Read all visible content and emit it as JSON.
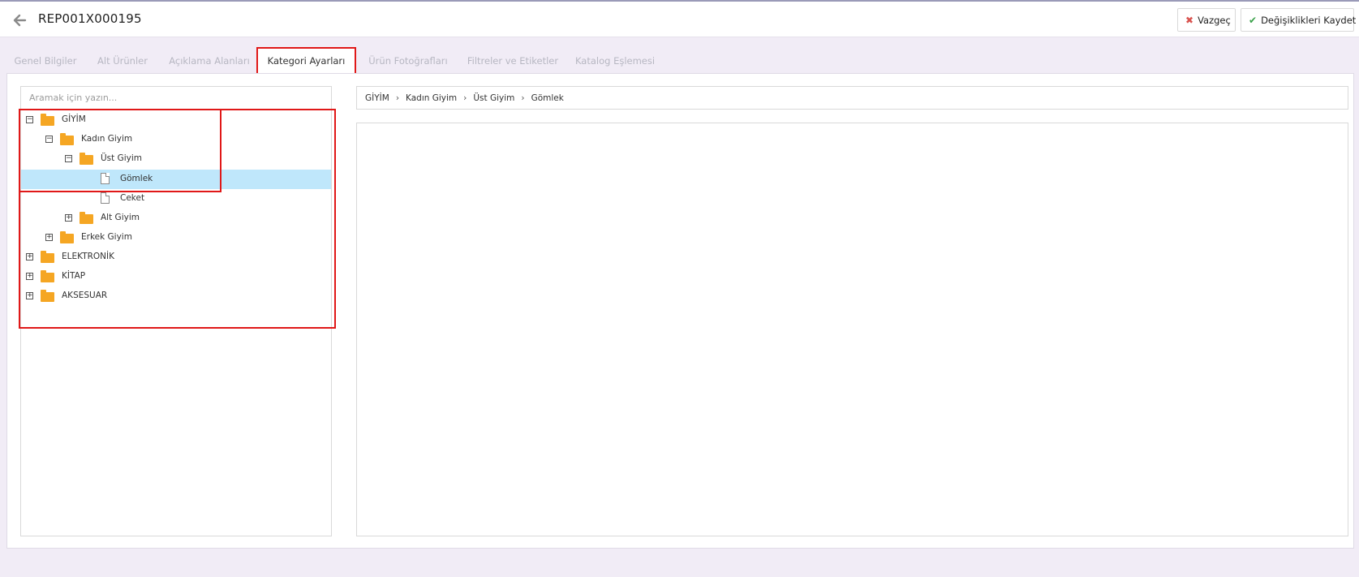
{
  "header": {
    "title": "REP001X000195",
    "cancel_label": "Vazgeç",
    "save_label": "Değişiklikleri Kaydet"
  },
  "tabs": [
    {
      "label": "Genel Bilgiler",
      "active": false
    },
    {
      "label": "Alt Ürünler",
      "active": false
    },
    {
      "label": "Açıklama Alanları",
      "active": false
    },
    {
      "label": "Kategori Ayarları",
      "active": true
    },
    {
      "label": "Ürün Fotoğrafları",
      "active": false
    },
    {
      "label": "Filtreler ve Etiketler",
      "active": false
    },
    {
      "label": "Katalog Eşlemesi",
      "active": false
    }
  ],
  "tree": {
    "search_placeholder": "Aramak için yazın...",
    "nodes": [
      {
        "label": "GİYİM",
        "type": "folder",
        "expanded": true
      },
      {
        "label": "Kadın Giyim",
        "type": "folder",
        "expanded": true
      },
      {
        "label": "Üst Giyim",
        "type": "folder",
        "expanded": true
      },
      {
        "label": "Gömlek",
        "type": "file",
        "selected": true
      },
      {
        "label": "Ceket",
        "type": "file"
      },
      {
        "label": "Alt Giyim",
        "type": "folder",
        "expanded": false
      },
      {
        "label": "Erkek Giyim",
        "type": "folder",
        "expanded": false
      },
      {
        "label": "ELEKTRONİK",
        "type": "folder",
        "expanded": false
      },
      {
        "label": "KİTAP",
        "type": "folder",
        "expanded": false
      },
      {
        "label": "AKSESUAR",
        "type": "folder",
        "expanded": false
      }
    ]
  },
  "breadcrumb": [
    "GİYİM",
    "Kadın Giyim",
    "Üst Giyim",
    "Gömlek"
  ],
  "icons": {
    "back": "arrow-left-icon",
    "cancel": "close-icon",
    "save": "check-icon",
    "expanded": "minus-box-icon",
    "collapsed": "plus-box-icon",
    "folder": "folder-icon",
    "file": "file-icon",
    "separator": "chevron-right-icon"
  },
  "colors": {
    "folder": "#f5a623",
    "selected_row": "#bfe7fb",
    "highlight": "#e01818",
    "background": "#f1ecf6"
  }
}
